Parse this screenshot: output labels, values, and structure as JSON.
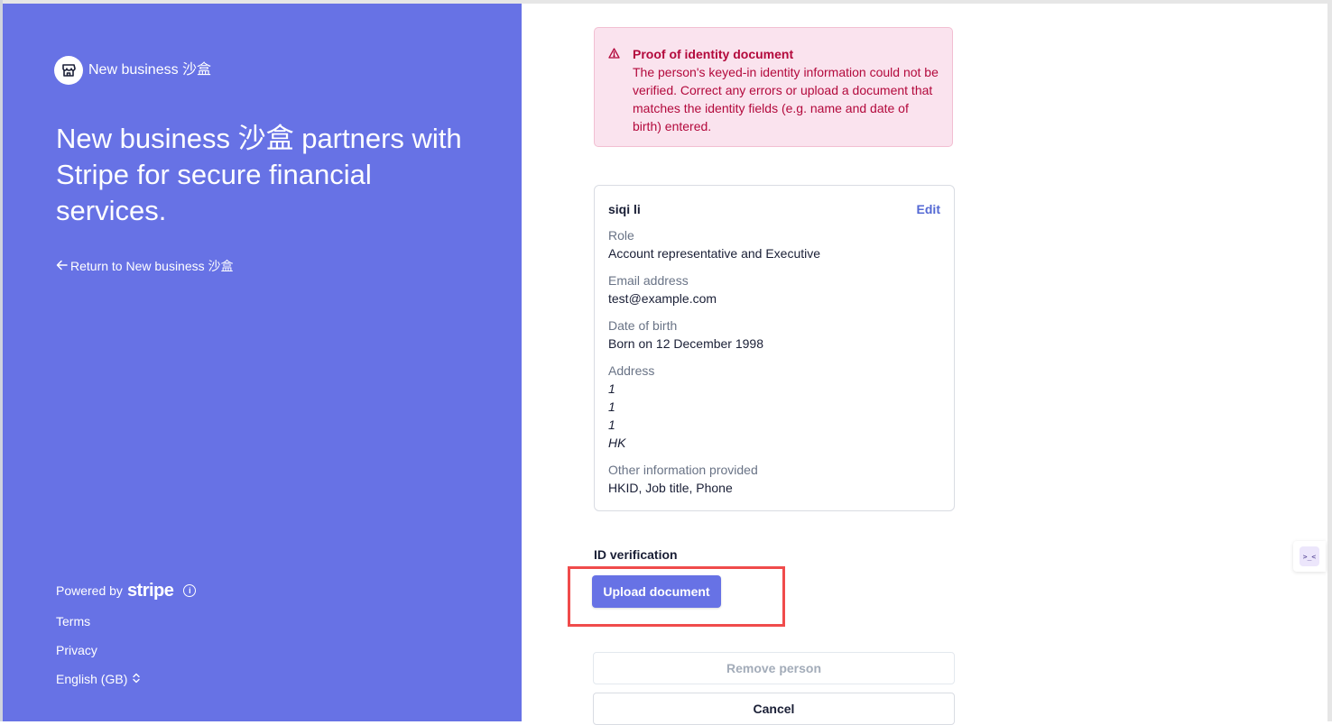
{
  "brand": {
    "name": "New business 沙盒",
    "headline": "New business 沙盒 partners with Stripe for secure financial services.",
    "return_link": "Return to New business 沙盒"
  },
  "footer": {
    "powered_by": "Powered by",
    "stripe_word": "stripe",
    "terms": "Terms",
    "privacy": "Privacy",
    "language": "English (GB)"
  },
  "alert": {
    "title": "Proof of identity document",
    "body": "The person's keyed-in identity information could not be verified. Correct any errors or upload a document that matches the identity fields (e.g. name and date of birth) entered."
  },
  "person": {
    "name": "siqi li",
    "edit_label": "Edit",
    "role_label": "Role",
    "role_value": "Account representative and Executive",
    "email_label": "Email address",
    "email_value": "test@example.com",
    "dob_label": "Date of birth",
    "dob_value": "Born on 12 December 1998",
    "address_label": "Address",
    "address_lines": [
      "1",
      "1",
      "1",
      "HK"
    ],
    "other_label": "Other information provided",
    "other_value": "HKID, Job title, Phone"
  },
  "id_verification": {
    "title": "ID verification",
    "upload_label": "Upload document"
  },
  "actions": {
    "remove_label": "Remove person",
    "cancel_label": "Cancel"
  },
  "widget": {
    "glyph": ">_<"
  },
  "colors": {
    "brand_panel": "#6772e5",
    "alert_text": "#b3093c",
    "alert_bg": "#fae3ee",
    "link": "#5469d4",
    "highlight": "#f04b4b"
  }
}
